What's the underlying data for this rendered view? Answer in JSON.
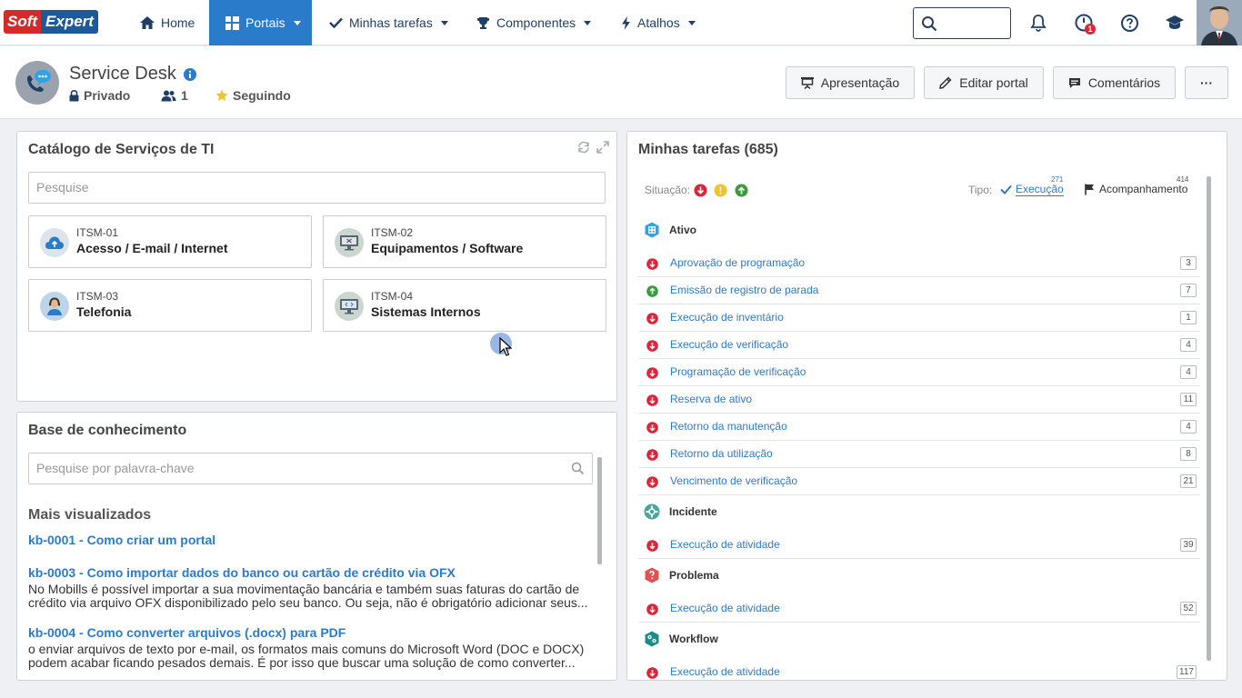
{
  "brand": {
    "logo_part1": "Soft",
    "logo_part2": "Expert"
  },
  "nav": {
    "home": "Home",
    "portais": "Portais",
    "minhas_tarefas": "Minhas tarefas",
    "componentes": "Componentes",
    "atalhos": "Atalhos",
    "notification_badge": "1"
  },
  "header": {
    "title": "Service Desk",
    "privacy": "Privado",
    "members": "1",
    "following": "Seguindo",
    "btn_presentation": "Apresentação",
    "btn_edit": "Editar portal",
    "btn_comments": "Comentários",
    "btn_more": "···"
  },
  "catalog": {
    "title": "Catálogo de Serviços de TI",
    "search_placeholder": "Pesquise",
    "items": [
      {
        "code": "ITSM-01",
        "name": "Acesso / E-mail / Internet"
      },
      {
        "code": "ITSM-02",
        "name": "Equipamentos / Software"
      },
      {
        "code": "ITSM-03",
        "name": "Telefonia"
      },
      {
        "code": "ITSM-04",
        "name": "Sistemas Internos"
      }
    ]
  },
  "knowledge": {
    "title": "Base de conhecimento",
    "search_placeholder": "Pesquise por palavra-chave",
    "section": "Mais visualizados",
    "articles": [
      {
        "title": "kb-0001 - Como criar um portal",
        "line1": "",
        "line2": ""
      },
      {
        "title": "kb-0003 - Como importar dados do banco ou cartão de crédito via OFX",
        "line1": "No Mobills é possível importar a sua movimentação bancária e também suas faturas do cartão de",
        "line2": "crédito via arquivo OFX disponibilizado pelo seu banco. Ou seja, não é obrigatório adicionar seus..."
      },
      {
        "title": "kb-0004 - Como converter arquivos (.docx) para PDF",
        "line1": "o enviar arquivos de texto por e-mail, os formatos mais comuns do Microsoft Word (DOC e DOCX)",
        "line2": "podem acabar ficando pesados demais. É por isso que buscar uma solução de como converter..."
      }
    ]
  },
  "tasks": {
    "title": "Minhas tarefas (685)",
    "situation_label": "Situação:",
    "type_label": "Tipo:",
    "execution_label": "Execução",
    "execution_count": "271",
    "follow_label": "Acompanhamento",
    "follow_count": "414",
    "colors": {
      "late": "#d9263a",
      "warning": "#f2c12e",
      "ok": "#3c9a3f"
    },
    "groups": [
      {
        "name": "Ativo",
        "icon": "building-icon",
        "color": "#2fa3e6"
      },
      {
        "name": "Incidente",
        "icon": "incident-icon",
        "color": "#4aa59a"
      },
      {
        "name": "Problema",
        "icon": "problem-icon",
        "color": "#e05252"
      },
      {
        "name": "Workflow",
        "icon": "workflow-icon",
        "color": "#1e8a8a"
      }
    ],
    "rows": [
      {
        "name": "Aprovação de programação",
        "count": "3",
        "status": "late"
      },
      {
        "name": "Emissão de registro de parada",
        "count": "7",
        "status": "ok"
      },
      {
        "name": "Execução de inventário",
        "count": "1",
        "status": "late"
      },
      {
        "name": "Execução de verificação",
        "count": "4",
        "status": "late"
      },
      {
        "name": "Programação de verificação",
        "count": "4",
        "status": "late"
      },
      {
        "name": "Reserva de ativo",
        "count": "11",
        "status": "late"
      },
      {
        "name": "Retorno da manutenção",
        "count": "4",
        "status": "late"
      },
      {
        "name": "Retorno da utilização",
        "count": "8",
        "status": "late"
      },
      {
        "name": "Vencimento de verificação",
        "count": "21",
        "status": "late"
      },
      {
        "name": "Execução de atividade",
        "count": "39",
        "status": "late"
      },
      {
        "name": "Execução de atividade",
        "count": "52",
        "status": "late"
      },
      {
        "name": "Execução de atividade",
        "count": "117",
        "status": "late"
      }
    ]
  }
}
